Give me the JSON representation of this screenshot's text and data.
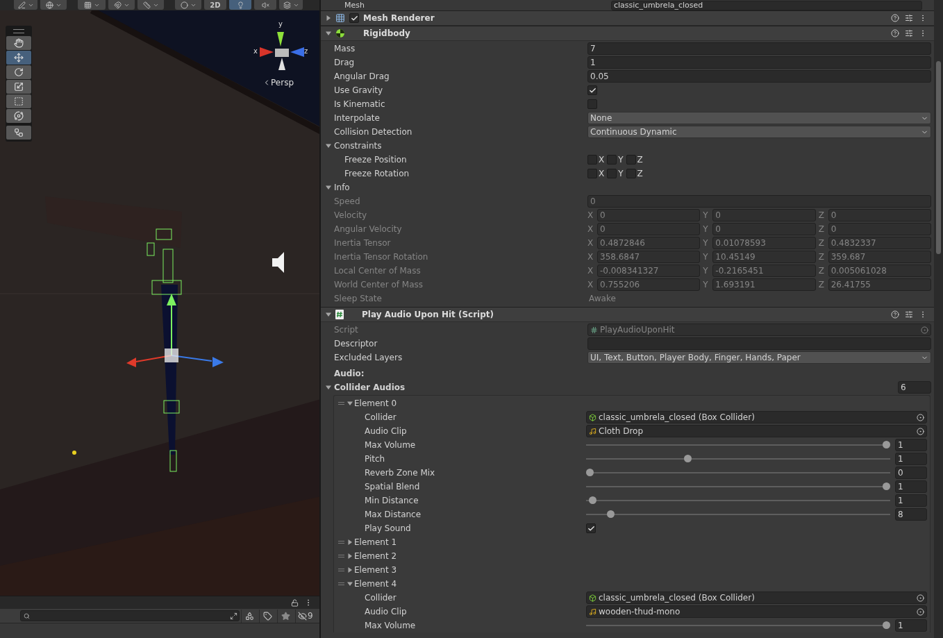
{
  "scene_toolbar": {
    "mode_label": "2D",
    "mode_2d_on": false,
    "lighting_on": true,
    "audio_on": false
  },
  "tools": [
    {
      "kind": "hand",
      "selected": false
    },
    {
      "kind": "move",
      "selected": true
    },
    {
      "kind": "rotate",
      "selected": false
    },
    {
      "kind": "scale",
      "selected": false
    },
    {
      "kind": "rect",
      "selected": false
    },
    {
      "kind": "transform",
      "selected": false
    },
    {
      "kind": "custom",
      "selected": false
    }
  ],
  "view_gizmo": {
    "y_label": "y",
    "x_label": "x",
    "z_label": "z",
    "projection": "Persp"
  },
  "project_panel": {
    "hidden_count": "9"
  },
  "inspector": {
    "top_row": {
      "label": "Mesh",
      "value": "classic_umbrela_closed"
    },
    "components": [
      {
        "title": "Mesh Renderer",
        "expanded": false,
        "enabled": true
      },
      {
        "title": "Rigidbody",
        "expanded": true,
        "fields": [
          {
            "kind": "text",
            "label": "Mass",
            "value": "7"
          },
          {
            "kind": "text",
            "label": "Drag",
            "value": "1"
          },
          {
            "kind": "text",
            "label": "Angular Drag",
            "value": "0.05"
          },
          {
            "kind": "checkbox",
            "label": "Use Gravity",
            "checked": true
          },
          {
            "kind": "checkbox",
            "label": "Is Kinematic",
            "checked": false
          },
          {
            "kind": "dropdown",
            "label": "Interpolate",
            "value": "None"
          },
          {
            "kind": "dropdown",
            "label": "Collision Detection",
            "value": "Continuous Dynamic"
          },
          {
            "kind": "foldout",
            "label": "Constraints",
            "expanded": true,
            "children": [
              {
                "kind": "toggles",
                "label": "Freeze Position",
                "toggles": [
                  {
                    "label": "X",
                    "checked": false
                  },
                  {
                    "label": "Y",
                    "checked": false
                  },
                  {
                    "label": "Z",
                    "checked": false
                  }
                ]
              },
              {
                "kind": "toggles",
                "label": "Freeze Rotation",
                "toggles": [
                  {
                    "label": "X",
                    "checked": false
                  },
                  {
                    "label": "Y",
                    "checked": false
                  },
                  {
                    "label": "Z",
                    "checked": false
                  }
                ]
              }
            ]
          },
          {
            "kind": "foldout",
            "label": "Info",
            "expanded": true,
            "children": [
              {
                "kind": "text",
                "label": "Speed",
                "value": "0",
                "disabled": true
              },
              {
                "kind": "vector3",
                "label": "Velocity",
                "disabled": true,
                "axes": [
                  {
                    "label": "X",
                    "value": "0"
                  },
                  {
                    "label": "Y",
                    "value": "0"
                  },
                  {
                    "label": "Z",
                    "value": "0"
                  }
                ]
              },
              {
                "kind": "vector3",
                "label": "Angular Velocity",
                "disabled": true,
                "axes": [
                  {
                    "label": "X",
                    "value": "0"
                  },
                  {
                    "label": "Y",
                    "value": "0"
                  },
                  {
                    "label": "Z",
                    "value": "0"
                  }
                ]
              },
              {
                "kind": "vector3",
                "label": "Inertia Tensor",
                "disabled": true,
                "axes": [
                  {
                    "label": "X",
                    "value": "0.4872846"
                  },
                  {
                    "label": "Y",
                    "value": "0.01078593"
                  },
                  {
                    "label": "Z",
                    "value": "0.4832337"
                  }
                ]
              },
              {
                "kind": "vector3",
                "label": "Inertia Tensor Rotation",
                "disabled": true,
                "axes": [
                  {
                    "label": "X",
                    "value": "358.6847"
                  },
                  {
                    "label": "Y",
                    "value": "10.45149"
                  },
                  {
                    "label": "Z",
                    "value": "359.687"
                  }
                ]
              },
              {
                "kind": "vector3",
                "label": "Local Center of Mass",
                "disabled": true,
                "axes": [
                  {
                    "label": "X",
                    "value": "-0.008341327"
                  },
                  {
                    "label": "Y",
                    "value": "-0.2165451"
                  },
                  {
                    "label": "Z",
                    "value": "0.005061028"
                  }
                ]
              },
              {
                "kind": "vector3",
                "label": "World Center of Mass",
                "disabled": true,
                "axes": [
                  {
                    "label": "X",
                    "value": "0.755206"
                  },
                  {
                    "label": "Y",
                    "value": "1.693191"
                  },
                  {
                    "label": "Z",
                    "value": "26.41755"
                  }
                ]
              },
              {
                "kind": "plain",
                "label": "Sleep State",
                "value": "Awake",
                "disabled": true
              }
            ]
          }
        ]
      },
      {
        "title": "Play Audio Upon Hit (Script)",
        "expanded": true,
        "fields": [
          {
            "kind": "script_ref",
            "label": "Script",
            "value": "PlayAudioUponHit",
            "disabled": true
          },
          {
            "kind": "text",
            "label": "Descriptor"
          },
          {
            "kind": "dropdown",
            "label": "Excluded Layers",
            "value": "UI, Text, Button, Player Body, Finger, Hands, Paper"
          },
          {
            "kind": "header",
            "label": "Audio:"
          },
          {
            "kind": "array",
            "label": "Collider Audios",
            "count": "6",
            "expanded": true,
            "elements": [
              {
                "label": "Element 0",
                "expanded": true,
                "children": [
                  {
                    "kind": "collider_ref",
                    "label": "Collider",
                    "value": "classic_umbrela_closed (Box Collider)"
                  },
                  {
                    "kind": "audio_ref",
                    "label": "Audio Clip",
                    "value": "Cloth Drop"
                  },
                  {
                    "kind": "slider",
                    "label": "Max Volume",
                    "level": 1,
                    "value": "1"
                  },
                  {
                    "kind": "slider",
                    "label": "Pitch",
                    "level": 0.33,
                    "value": "1"
                  },
                  {
                    "kind": "slider",
                    "label": "Reverb Zone Mix",
                    "level": 0,
                    "value": "0"
                  },
                  {
                    "kind": "slider",
                    "label": "Spatial Blend",
                    "level": 1,
                    "value": "1"
                  },
                  {
                    "kind": "slider",
                    "label": "Min Distance",
                    "level": 0.01,
                    "value": "1"
                  },
                  {
                    "kind": "slider",
                    "label": "Max Distance",
                    "level": 0.07,
                    "value": "8"
                  },
                  {
                    "kind": "checkbox",
                    "label": "Play Sound",
                    "checked": true
                  }
                ]
              },
              {
                "label": "Element 1",
                "expanded": false
              },
              {
                "label": "Element 2",
                "expanded": false
              },
              {
                "label": "Element 3",
                "expanded": false
              },
              {
                "label": "Element 4",
                "expanded": true,
                "children": [
                  {
                    "kind": "collider_ref",
                    "label": "Collider",
                    "value": "classic_umbrela_closed (Box Collider)"
                  },
                  {
                    "kind": "audio_ref",
                    "label": "Audio Clip",
                    "value": "wooden-thud-mono"
                  },
                  {
                    "kind": "slider",
                    "label": "Max Volume",
                    "level": 1,
                    "value": "1"
                  }
                ]
              }
            ]
          }
        ]
      }
    ]
  }
}
